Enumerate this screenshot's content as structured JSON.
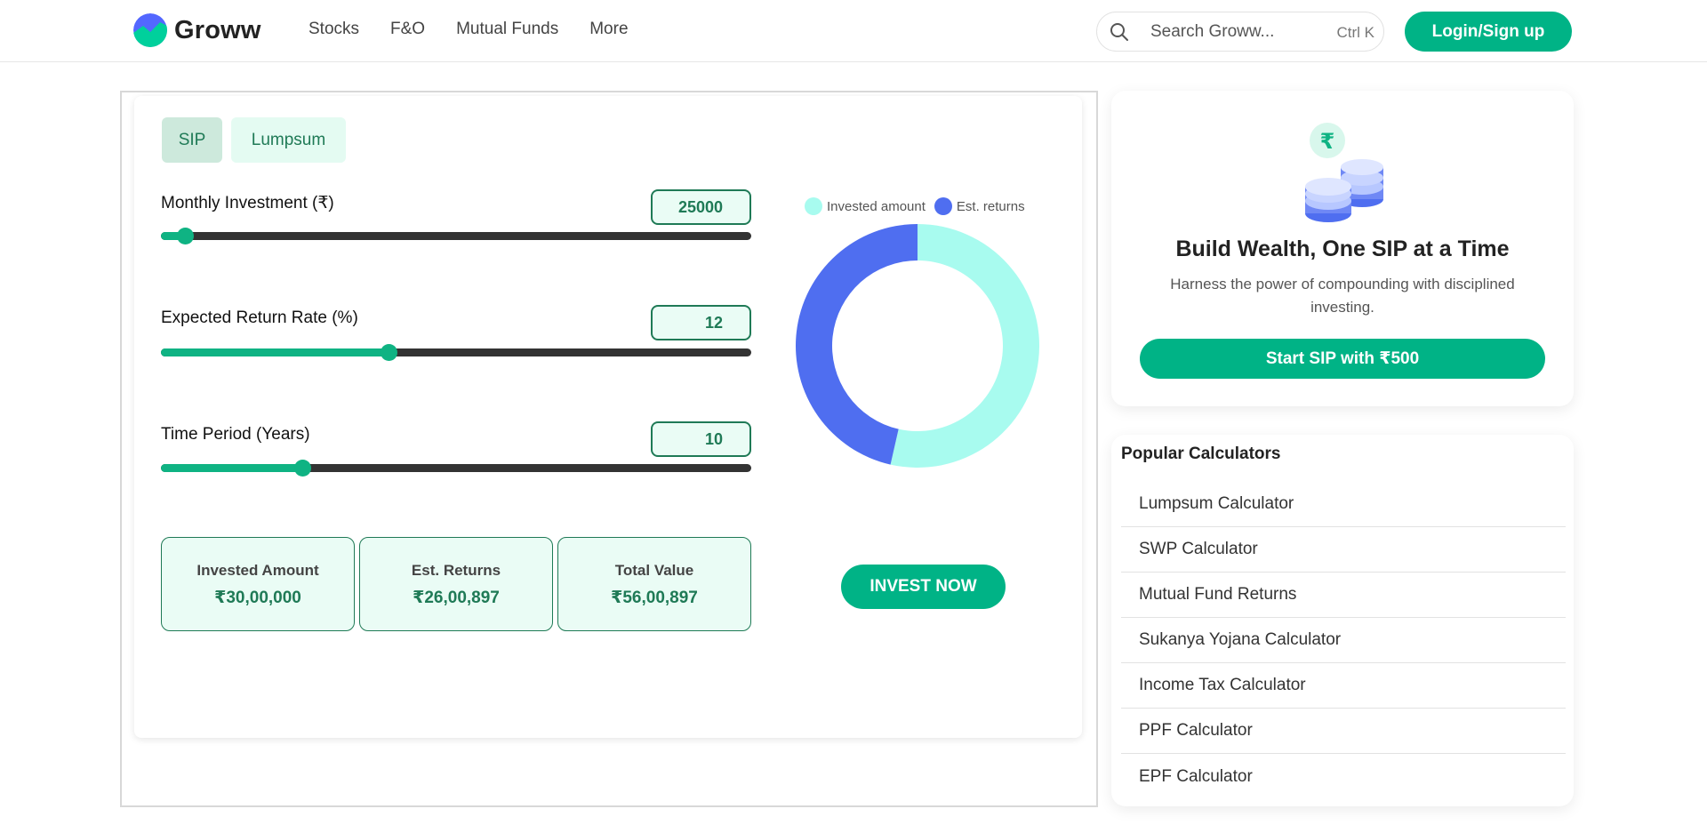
{
  "header": {
    "brand": "Groww",
    "nav": [
      "Stocks",
      "F&O",
      "Mutual Funds",
      "More"
    ],
    "search_placeholder": "Search Groww...",
    "search_shortcut": "Ctrl K",
    "login_label": "Login/Sign up"
  },
  "calculator": {
    "tabs": [
      {
        "label": "SIP",
        "active": true
      },
      {
        "label": "Lumpsum",
        "active": false
      }
    ],
    "fields": [
      {
        "label": "Monthly Investment (₹)",
        "value": "25000",
        "slider_fraction": 0.04
      },
      {
        "label": "Expected Return Rate (%)",
        "value": "12",
        "slider_fraction": 0.385
      },
      {
        "label": "Time Period (Years)",
        "value": "10",
        "slider_fraction": 0.24
      }
    ],
    "results": [
      {
        "label": "Invested Amount",
        "value": "₹30,00,000"
      },
      {
        "label": "Est. Returns",
        "value": "₹26,00,897"
      },
      {
        "label": "Total Value",
        "value": "₹56,00,897"
      }
    ],
    "invest_button": "INVEST NOW"
  },
  "chart_data": {
    "type": "pie",
    "donut": true,
    "labels": [
      "Invested amount",
      "Est. returns"
    ],
    "values": [
      3000000,
      2600897
    ],
    "colors": [
      "#a8fbef",
      "#4f6ef0"
    ],
    "legend_position": "top"
  },
  "promo": {
    "icon_symbol": "₹",
    "title": "Build Wealth, One SIP at a Time",
    "subtitle": "Harness the power of compounding with disciplined investing.",
    "button": "Start SIP with ₹500"
  },
  "popular": {
    "title": "Popular Calculators",
    "items": [
      "Lumpsum Calculator",
      "SWP Calculator",
      "Mutual Fund Returns",
      "Sukanya Yojana Calculator",
      "Income Tax Calculator",
      "PPF Calculator",
      "EPF Calculator"
    ]
  },
  "colors": {
    "brand_green": "#00b386",
    "dark_green": "#1f7a56",
    "invested": "#a8fbef",
    "returns": "#4f6ef0"
  }
}
